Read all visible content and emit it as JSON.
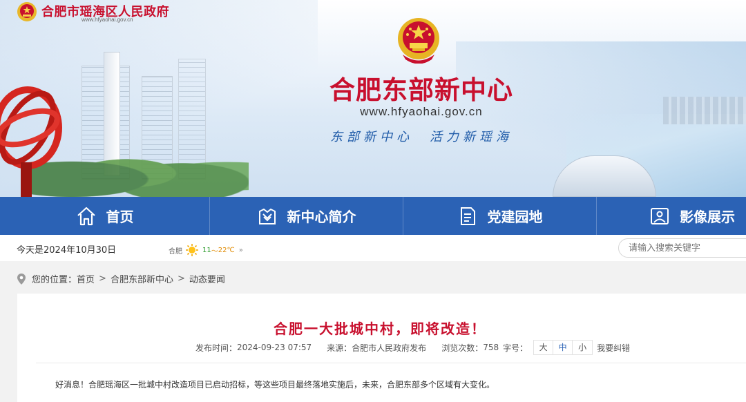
{
  "header": {
    "gov_name": "合肥市瑶海区人民政府",
    "gov_url": "www.hfyaohai.gov.cn",
    "site_title": "合肥东部新中心",
    "site_url": "www.hfyaohai.gov.cn",
    "slogan": "东部新中心　活力新瑶海",
    "brand_color": "#c8102e"
  },
  "nav": {
    "color": "#2b62b5",
    "items": [
      {
        "label": "首页",
        "icon": "home-icon"
      },
      {
        "label": "新中心简介",
        "icon": "intro-icon"
      },
      {
        "label": "党建园地",
        "icon": "document-icon"
      },
      {
        "label": "影像展示",
        "icon": "image-icon"
      }
    ]
  },
  "infobar": {
    "date": "今天是2024年10月30日",
    "city": "合肥",
    "temp_low": "11",
    "temp_high": "22℃",
    "temp_sep": "～",
    "more": "»",
    "search_placeholder": "请输入搜索关键字"
  },
  "breadcrumb": {
    "prefix": "您的位置：",
    "items": [
      "首页",
      "合肥东部新中心",
      "动态要闻"
    ],
    "sep": ">"
  },
  "article": {
    "title": "合肥一大批城中村，即将改造！",
    "publish_label": "发布时间：",
    "publish_time": "2024-09-23 07:57",
    "source_label": "来源：",
    "source": "合肥市人民政府发布",
    "views_label": "浏览次数：",
    "views": "758",
    "font_label": "字号：",
    "font_sizes": [
      "大",
      "中",
      "小"
    ],
    "correct_label": "我要纠错",
    "body": "好消息！合肥瑶海区一批城中村改造项目已启动招标，等这些项目最终落地实施后，未来，合肥东部多个区域有大变化。"
  }
}
